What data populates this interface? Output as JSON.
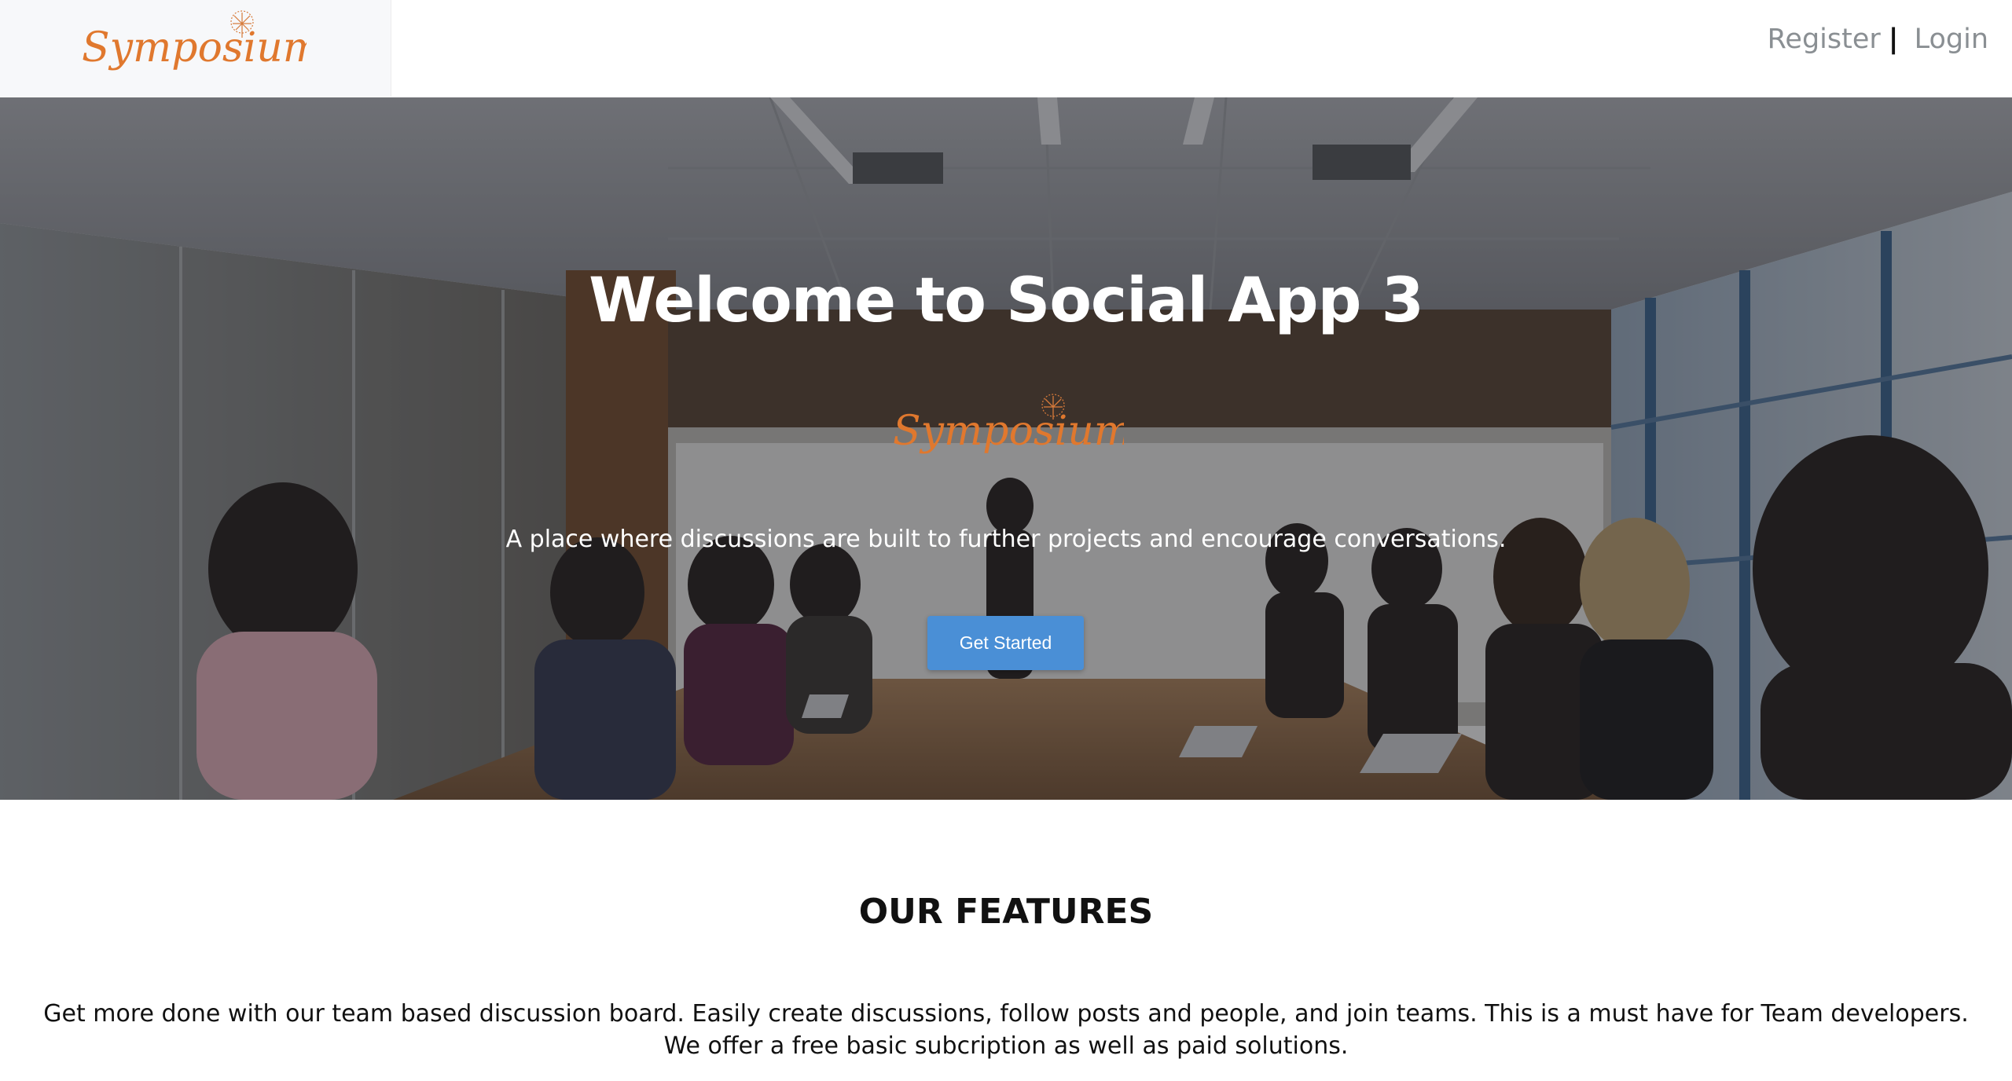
{
  "brand": {
    "logo_text": "Symposium",
    "logo_color": "#e0782e"
  },
  "nav": {
    "register_label": "Register",
    "separator": "|",
    "login_label": "Login"
  },
  "hero": {
    "title": "Welcome to Social App 3",
    "logo_text": "Symposium",
    "tagline": "A place where discussions are built to further projects and encourage conversations.",
    "cta_label": "Get Started",
    "cta_color": "#4a8fd6"
  },
  "features": {
    "heading": "OUR FEATURES",
    "description": "Get more done with our team based discussion board. Easily create discussions, follow posts and people, and join teams. This is a must have for Team developers. We offer a free basic subcription as well as paid solutions."
  }
}
